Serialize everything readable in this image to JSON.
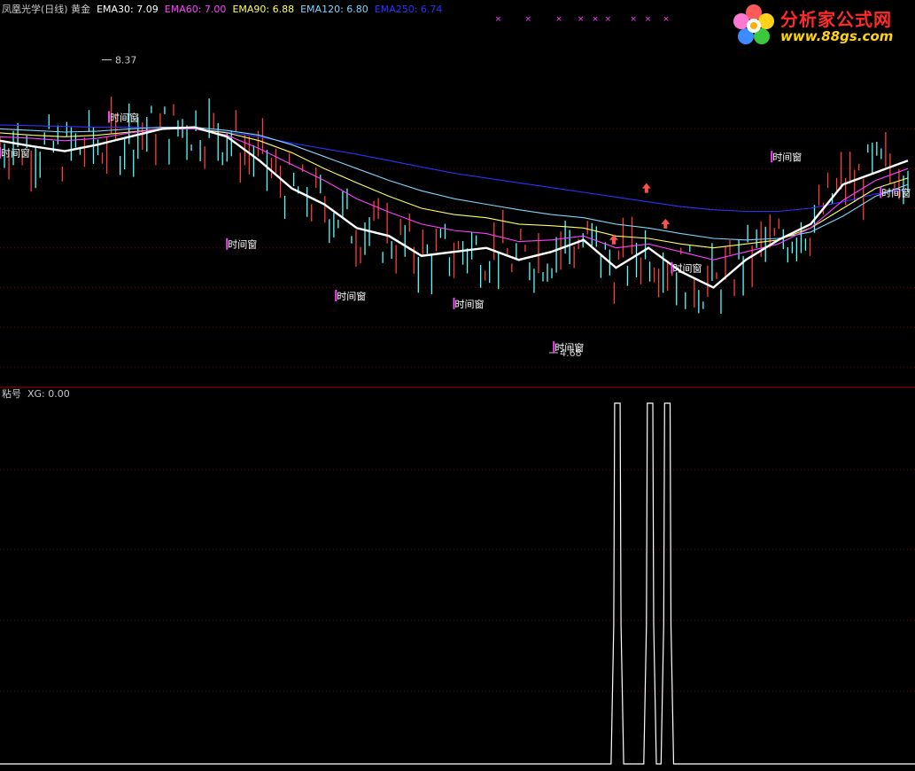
{
  "colors": {
    "bg": "#000000",
    "grid": "#6e0000",
    "divider": "#b00000",
    "up": "#ff3c3c",
    "down": "#54ffff",
    "ema30": "#ffffff",
    "ema60": "#ff40ff",
    "ema90": "#ffff60",
    "ema120": "#7fd4ff",
    "ema250": "#3030ff",
    "marker": "#ff40ff",
    "arrow": "#ff5050",
    "xg": "#ffffff"
  },
  "header": {
    "title": "凤凰光学(日线) 黄金",
    "ema30_label": "EMA30: 7.09",
    "ema60_label": "EMA60: 7.00",
    "ema90_label": "EMA90: 6.88",
    "ema120_label": "EMA120: 6.80",
    "ema250_label": "EMA250: 6.74"
  },
  "sub_header": {
    "title": "粘号",
    "xg_label": "XG: 0.00"
  },
  "logo": {
    "line1": "分析家公式网",
    "line2": "www.88gs.com"
  },
  "chart_data": [
    {
      "type": "line",
      "title": "凤凰光学(日线) 黄金",
      "ylim": [
        4.3,
        8.9
      ],
      "grid": true,
      "series": [
        {
          "name": "EMA30",
          "color": "#ffffff",
          "values": [
            7.35,
            7.28,
            7.22,
            7.3,
            7.4,
            7.5,
            7.52,
            7.4,
            7.1,
            6.75,
            6.55,
            6.25,
            6.15,
            5.9,
            5.95,
            6.0,
            5.85,
            5.95,
            6.1,
            5.75,
            6.0,
            5.7,
            5.5,
            5.85,
            6.1,
            6.3,
            6.8,
            6.95,
            7.1
          ]
        },
        {
          "name": "EMA60",
          "color": "#ff40ff",
          "values": [
            7.4,
            7.38,
            7.35,
            7.38,
            7.45,
            7.5,
            7.5,
            7.42,
            7.25,
            7.05,
            6.85,
            6.62,
            6.45,
            6.3,
            6.22,
            6.18,
            6.08,
            6.1,
            6.15,
            6.0,
            6.05,
            5.95,
            5.85,
            5.95,
            6.05,
            6.25,
            6.6,
            6.85,
            7.0
          ]
        },
        {
          "name": "EMA90",
          "color": "#ffff60",
          "values": [
            7.45,
            7.42,
            7.4,
            7.42,
            7.46,
            7.5,
            7.5,
            7.45,
            7.35,
            7.2,
            7.0,
            6.82,
            6.65,
            6.5,
            6.42,
            6.38,
            6.3,
            6.28,
            6.25,
            6.15,
            6.12,
            6.05,
            6.0,
            6.05,
            6.1,
            6.25,
            6.5,
            6.75,
            6.88
          ]
        },
        {
          "name": "EMA120",
          "color": "#7fd4ff",
          "values": [
            7.5,
            7.48,
            7.46,
            7.47,
            7.5,
            7.52,
            7.52,
            7.48,
            7.42,
            7.3,
            7.15,
            7.0,
            6.85,
            6.72,
            6.62,
            6.55,
            6.48,
            6.42,
            6.38,
            6.3,
            6.25,
            6.18,
            6.12,
            6.1,
            6.12,
            6.2,
            6.4,
            6.65,
            6.8
          ]
        },
        {
          "name": "EMA250",
          "color": "#3030ff",
          "values": [
            7.55,
            7.54,
            7.53,
            7.52,
            7.52,
            7.51,
            7.5,
            7.46,
            7.4,
            7.32,
            7.25,
            7.18,
            7.1,
            7.02,
            6.94,
            6.88,
            6.82,
            6.76,
            6.7,
            6.64,
            6.58,
            6.52,
            6.48,
            6.46,
            6.46,
            6.5,
            6.58,
            6.68,
            6.74
          ]
        }
      ],
      "annotations": {
        "high": {
          "label": "8.37",
          "value": 8.37
        },
        "low": {
          "label": "4.68",
          "value": 4.68
        },
        "window_label": "时间窗",
        "window_points": [
          [
            0.0,
            7.15
          ],
          [
            0.12,
            7.6
          ],
          [
            0.25,
            6.0
          ],
          [
            0.37,
            5.35
          ],
          [
            0.5,
            5.25
          ],
          [
            0.61,
            4.7
          ],
          [
            0.74,
            5.7
          ],
          [
            0.85,
            7.1
          ],
          [
            0.97,
            6.65
          ]
        ],
        "cross_marks_x": [
          0.545,
          0.578,
          0.612,
          0.636,
          0.652,
          0.666,
          0.694,
          0.71,
          0.73
        ]
      }
    },
    {
      "type": "line",
      "title": "粘号",
      "ylim": [
        0,
        1
      ],
      "series": [
        {
          "name": "XG",
          "color": "#ffffff",
          "pulses": [
            {
              "start": 0.676,
              "end": 0.684
            },
            {
              "start": 0.712,
              "end": 0.72
            },
            {
              "start": 0.731,
              "end": 0.739
            }
          ]
        }
      ]
    }
  ]
}
